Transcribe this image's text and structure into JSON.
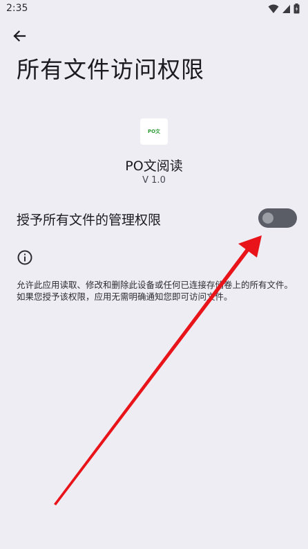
{
  "status_bar": {
    "time": "2:35",
    "icons": [
      "wifi-icon",
      "signal-icon",
      "battery-icon"
    ]
  },
  "header": {
    "back_icon": "arrow-left-icon",
    "title": "所有文件访问权限"
  },
  "app": {
    "icon_text": "PO文",
    "name": "PO文阅读",
    "version": "V 1.0"
  },
  "permission": {
    "label": "授予所有文件的管理权限",
    "enabled": false
  },
  "info": {
    "icon": "info-icon",
    "description": "允许此应用读取、修改和删除此设备或任何已连接存储卷上的所有文件。如果您授予该权限，应用无需明确通知您即可访问文件。"
  },
  "colors": {
    "background": "#eeedf3",
    "toggle_track_off": "#5a5c66",
    "annotation_arrow": "#e8141a"
  }
}
